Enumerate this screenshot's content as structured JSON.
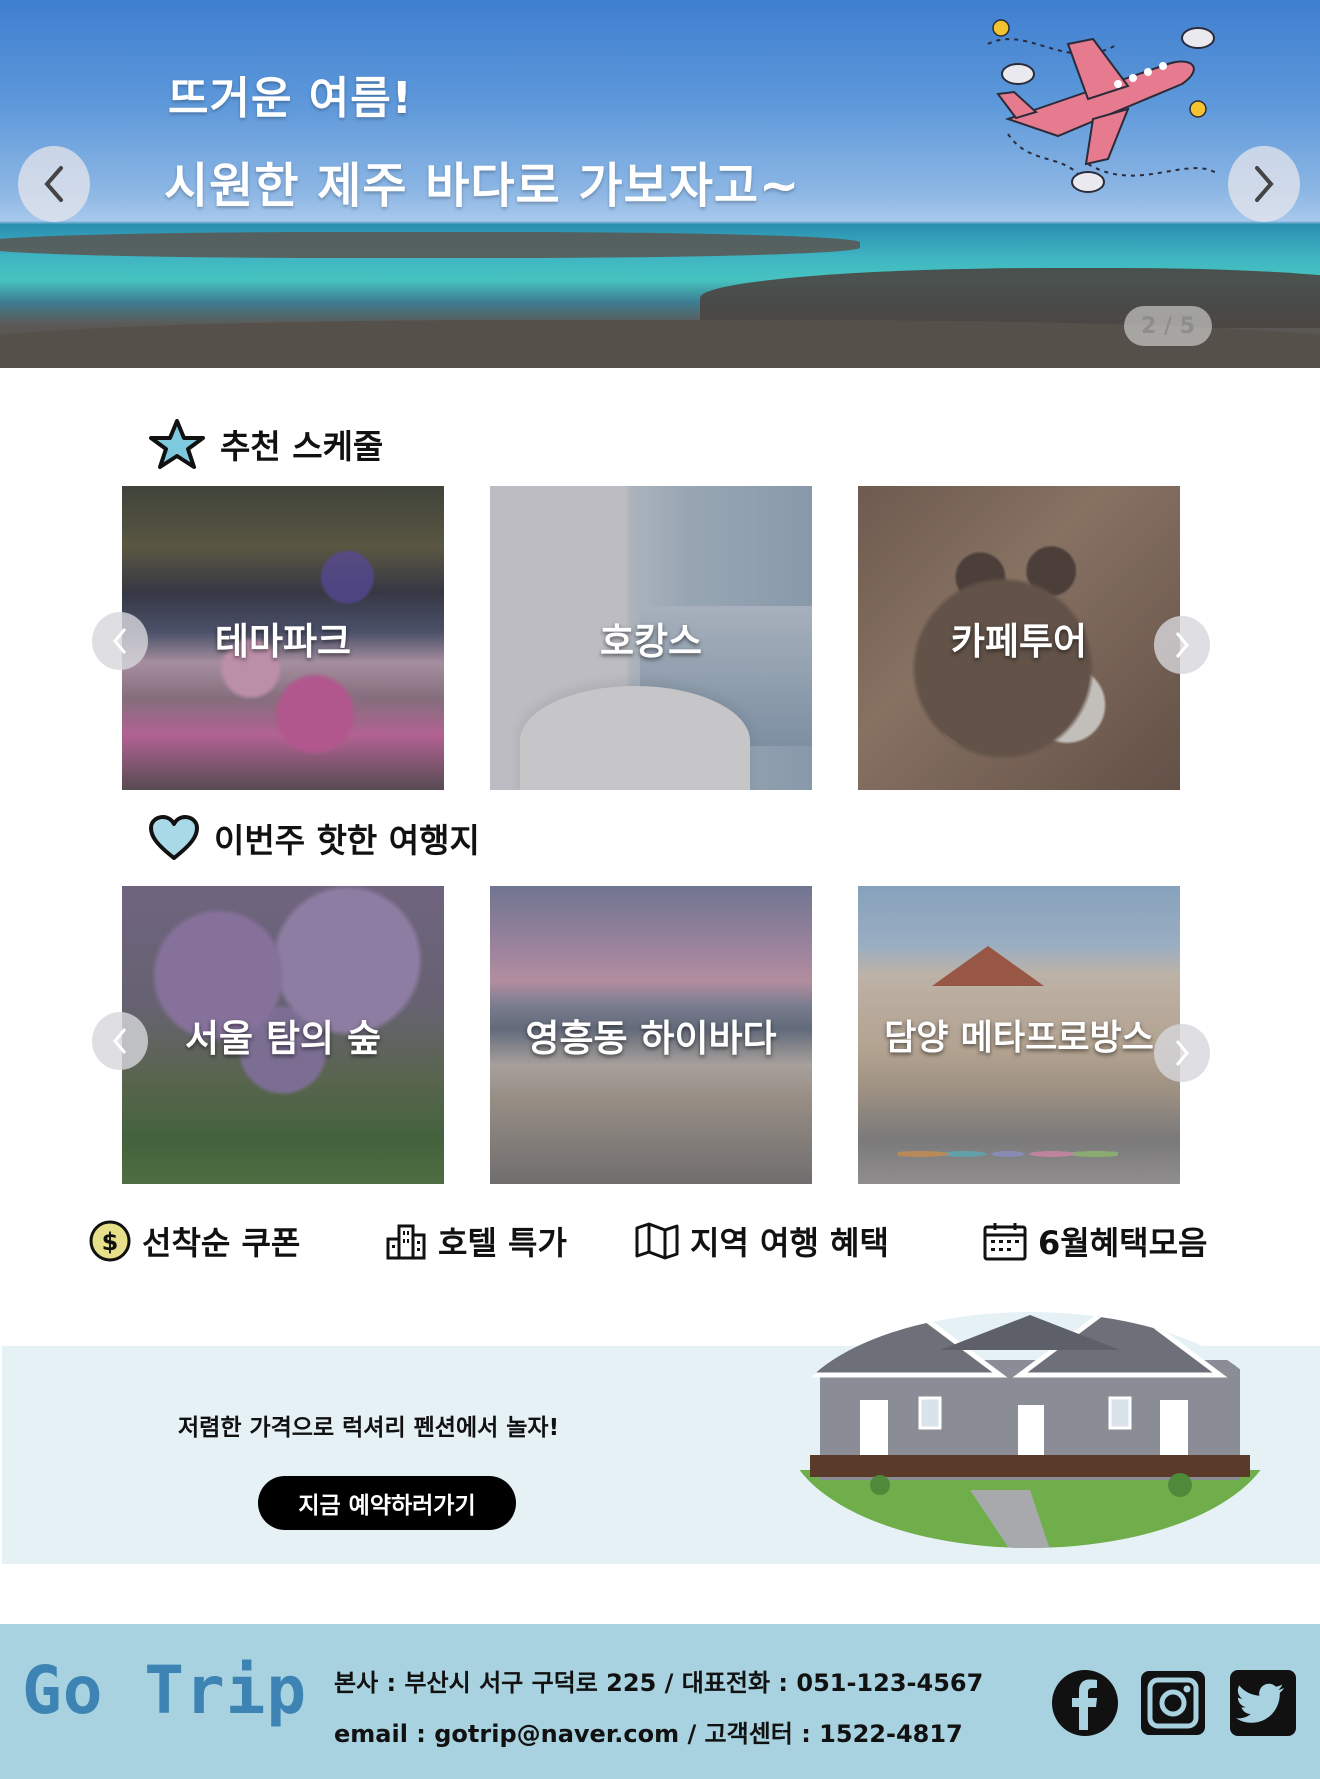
{
  "hero": {
    "line1": "뜨거운 여름!",
    "line2": "시원한 제주 바다로 가보자고~",
    "counter": "2 / 5",
    "prev_icon": "chevron-left-icon",
    "next_icon": "chevron-right-icon"
  },
  "recommended": {
    "title": "추천 스케줄",
    "icon": "star-icon",
    "cards": [
      {
        "label": "테마파크"
      },
      {
        "label": "호캉스"
      },
      {
        "label": "카페투어"
      }
    ]
  },
  "hot_places": {
    "title": "이번주 핫한 여행지",
    "icon": "heart-icon",
    "cards": [
      {
        "label": "서울 탐의 숲"
      },
      {
        "label": "영흥동 하이바다"
      },
      {
        "label": "담양 메타프로방스"
      }
    ]
  },
  "quick_links": [
    {
      "label": "선착순 쿠폰",
      "icon": "dollar-coin-icon"
    },
    {
      "label": "호텔 특가",
      "icon": "building-icon"
    },
    {
      "label": "지역 여행 혜택",
      "icon": "map-icon"
    },
    {
      "label": "6월혜택모음",
      "icon": "calendar-icon"
    }
  ],
  "banner": {
    "text": "저렴한 가격으로 럭셔리 펜션에서 놀자!",
    "button": "지금 예약하러가기"
  },
  "footer": {
    "logo": "Go Trip",
    "line1": "본사 : 부산시 서구 구덕로 225 / 대표전화 : 051-123-4567",
    "line2": "email : gotrip@naver.com / 고객센터 : 1522-4817",
    "social": [
      "facebook-icon",
      "instagram-icon",
      "twitter-icon"
    ]
  },
  "colors": {
    "footer_bg": "#a9d2e0",
    "banner_bg": "#e6f1f5",
    "logo": "#3d84b4",
    "button_bg": "#000000"
  }
}
